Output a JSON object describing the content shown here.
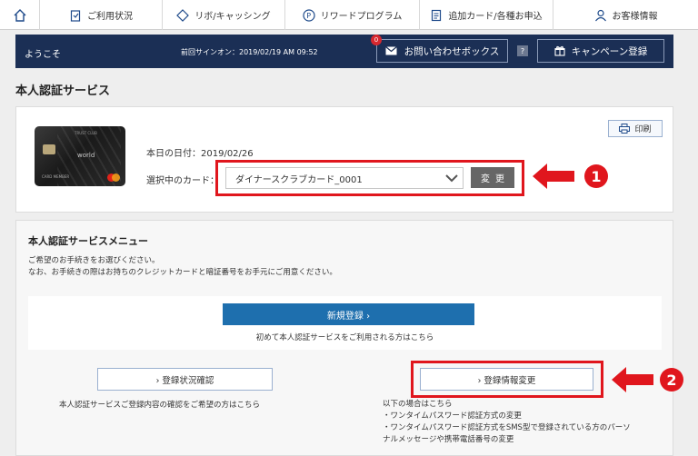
{
  "nav": {
    "items": [
      {
        "label": "ご利用状況",
        "icon": "clipboard-icon"
      },
      {
        "label": "リボ/キャッシング",
        "icon": "diamond-arrows-icon"
      },
      {
        "label": "リワードプログラム",
        "icon": "points-icon"
      },
      {
        "label": "追加カード/各種お申込",
        "icon": "document-icon"
      },
      {
        "label": "お客様情報",
        "icon": "person-icon"
      }
    ]
  },
  "welcome": {
    "greeting": "ようこそ",
    "last_signin": "前回サインオン：2019/02/19 AM 09:52",
    "inquiry_label": "お問い合わせボックス",
    "inquiry_badge": "0",
    "help": "?",
    "campaign_label": "キャンペーン登録"
  },
  "page": {
    "title": "本人認証サービス"
  },
  "card": {
    "today": "本日の日付：2019/02/26",
    "selected_label": "選択中のカード：",
    "selected_value": "ダイナースクラブカード_0001",
    "change_label": "変更",
    "print_label": "印刷",
    "card_brand": "world",
    "card_member": "CARD MEMBER",
    "card_top": "TRUST CLUB"
  },
  "callouts": {
    "one": "1",
    "two": "2"
  },
  "menu": {
    "title": "本人認証サービスメニュー",
    "desc_lines": [
      "ご希望のお手続きをお選びください。",
      "なお、お手続きの際はお持ちのクレジットカードと暗証番号をお手元にご用意ください。"
    ],
    "new_label": "新規登録 ›",
    "new_note": "初めて本人認証サービスをご利用される方はこちら",
    "status_label": "› 登録状況確認",
    "status_note": "本人認証サービスご登録内容の確認をご希望の方はこちら",
    "change_label": "› 登録情報変更",
    "change_notes": [
      "以下の場合はこちら",
      "・ワンタイムパスワード認証方式の変更",
      "・ワンタイムパスワード認証方式をSMS型で登録されている方のパーソ",
      "ナルメッセージや携帯電話番号の変更"
    ]
  },
  "colors": {
    "accent": "#1e6fae",
    "header": "#1b2f55",
    "highlight": "#e0161d"
  }
}
